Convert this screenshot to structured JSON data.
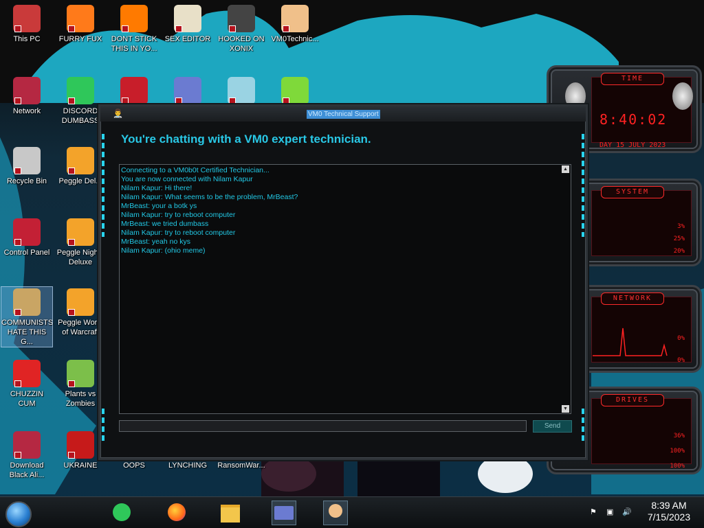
{
  "colors": {
    "accent_cyan": "#29c8e6",
    "alien_red": "#ff2222",
    "title_blue": "#3e8fd6"
  },
  "desktop_icons": [
    {
      "label": "This PC",
      "icon": "computer-icon"
    },
    {
      "label": "FURRY FUX",
      "icon": "firefox-icon"
    },
    {
      "label": "DONT STICK THIS IN YO...",
      "icon": "traffic-cone-icon"
    },
    {
      "label": "SEX EDITOR",
      "icon": "hex-editor-icon"
    },
    {
      "label": "HOOKED ON XONIX",
      "icon": "xonix-icon"
    },
    {
      "label": "VM0Technic...",
      "icon": "technician-icon"
    },
    {
      "label": "Network",
      "icon": "alien-network-icon"
    },
    {
      "label": "DISCORD DUMBASS",
      "icon": "chat-app-icon"
    },
    {
      "label": "",
      "icon": "dev-cpp-icon"
    },
    {
      "label": "",
      "icon": "card-app-icon"
    },
    {
      "label": "",
      "icon": "santa-icon"
    },
    {
      "label": "",
      "icon": "lime-icon"
    },
    {
      "label": "Recycle Bin",
      "icon": "recycle-bin-icon"
    },
    {
      "label": "Peggle Del...",
      "icon": "peggle-icon"
    },
    {
      "label": "Control Panel",
      "icon": "control-panel-icon"
    },
    {
      "label": "Peggle Nights Deluxe",
      "icon": "peggle-icon"
    },
    {
      "label": "COMMUNISTS HATE THIS G...",
      "icon": "money-bag-icon"
    },
    {
      "label": "Peggle World of Warcraft",
      "icon": "peggle-icon"
    },
    {
      "label": "CHUZZIN CUM",
      "icon": "chuzzle-icon"
    },
    {
      "label": "Plants vs Zombies",
      "icon": "flower-icon"
    },
    {
      "label": "Download Black Ali...",
      "icon": "alien-download-icon"
    },
    {
      "label": "UKRAINE",
      "icon": "radiation-icon"
    },
    {
      "label": "OOPS",
      "icon": "blank-icon"
    },
    {
      "label": "LYNCHING",
      "icon": "blank-icon"
    },
    {
      "label": "RansomWar...",
      "icon": "blank-icon"
    }
  ],
  "chat_window": {
    "title": "VM0 Technical Support",
    "headline": "You're chatting with a VM0 expert technician.",
    "messages": [
      "Connecting to a VM0b0t Certified Technician...",
      "You are now connected with Nilam Kapur",
      "Nilam Kapur: Hi there!",
      "Nilam Kapur: What seems to be the problem, MrBeast?",
      "MrBeast: your a botk ys",
      "Nilam Kapur: try to reboot computer",
      "MrBeast: we tried dumbass",
      "Nilam Kapur: try to reboot computer",
      "MrBeast: yeah no kys",
      "Nilam Kapur: (ohio meme)"
    ],
    "input_value": "",
    "send_label": "Send"
  },
  "widgets": {
    "time": {
      "title": "TIME",
      "clock": "8:40:02",
      "date": "DAY 15 JULY 2023"
    },
    "system": {
      "title": "SYSTEM",
      "values": [
        "3%",
        "25%",
        "20%"
      ]
    },
    "network": {
      "title": "NETWORK",
      "values": [
        "0%",
        "0%"
      ]
    },
    "drives": {
      "title": "DRIVES",
      "values": [
        "36%",
        "100%",
        "100%"
      ]
    }
  },
  "taskbar": {
    "time": "8:39 AM",
    "date": "7/15/2023",
    "pinned": [
      "chat-app-icon",
      "firefox-icon",
      "file-explorer-icon",
      "card-app-icon",
      "technician-icon"
    ]
  }
}
